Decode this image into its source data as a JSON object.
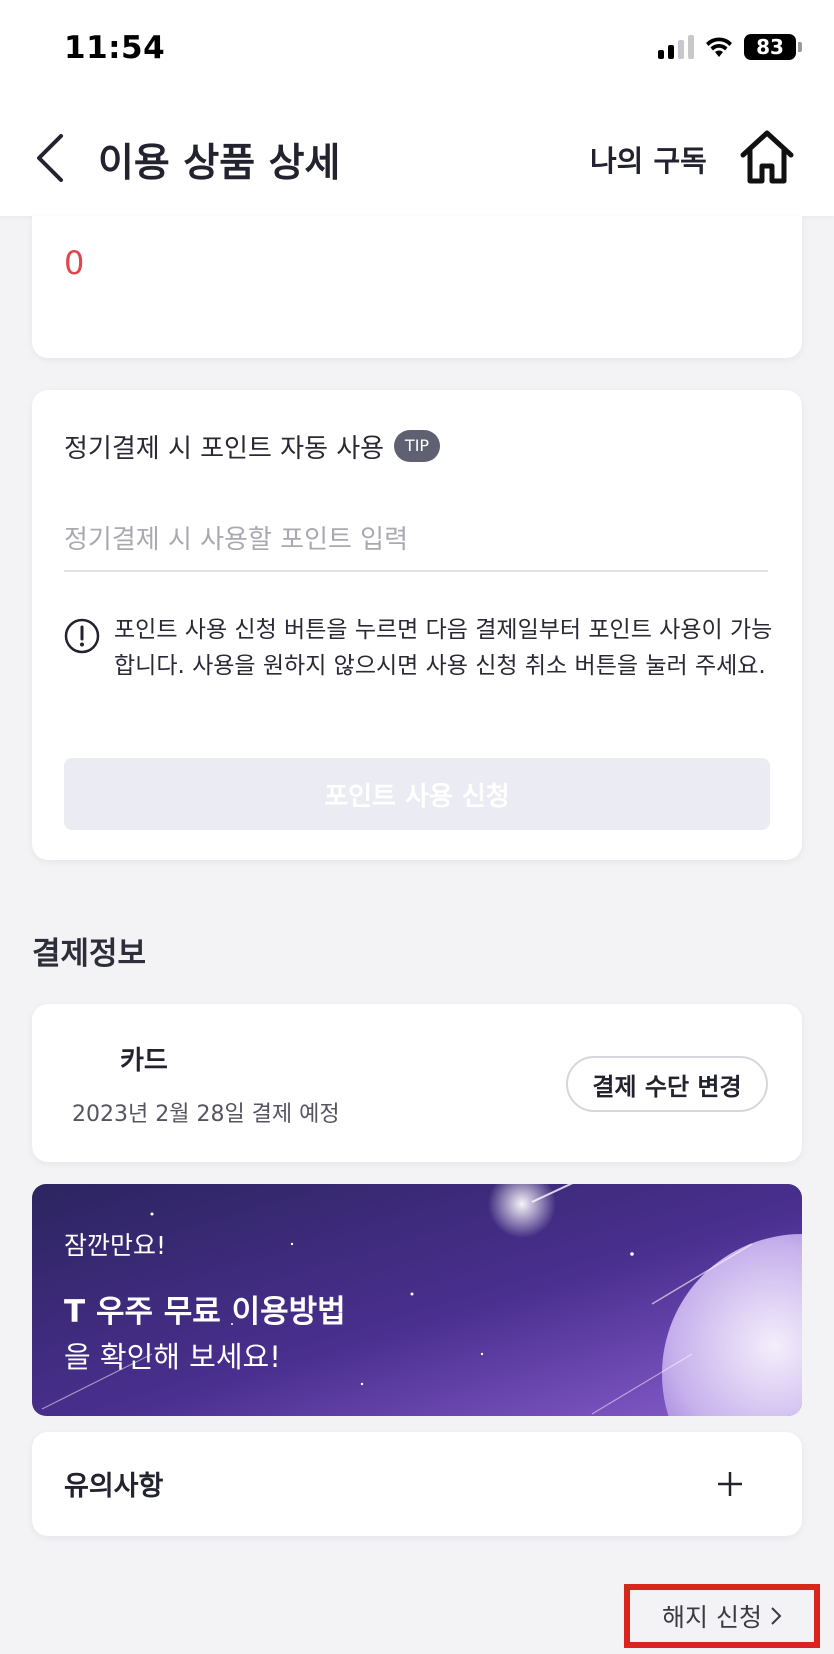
{
  "status_bar": {
    "time": "11:54",
    "battery": "83"
  },
  "header": {
    "title": "이용 상품 상세",
    "my_subscription": "나의 구독"
  },
  "point_card": {
    "value": "0"
  },
  "auto_point": {
    "title": "정기결제 시 포인트 자동 사용",
    "tip_badge": "TIP",
    "input_placeholder": "정기결제 시 사용할 포인트 입력",
    "notice": "포인트 사용 신청 버튼을 누르면 다음 결제일부터 포인트 사용이 가능합니다. 사용을 원하지 않으시면 사용 신청 취소 버튼을 눌러 주세요.",
    "apply_button": "포인트 사용 신청"
  },
  "payment": {
    "section_title": "결제정보",
    "method": "카드",
    "next_date": "2023년 2월 28일 결제 예정",
    "change_button": "결제 수단 변경"
  },
  "banner": {
    "subtitle": "잠깐만요!",
    "title": "T 우주 무료 이용방법",
    "description": "을 확인해 보세요!"
  },
  "notes": {
    "title": "유의사항"
  },
  "cancel": {
    "label": "해지 신청",
    "highlight_color": "#d8261f"
  },
  "colors": {
    "point_value": "#e0474c",
    "tip_badge": "#5f6172",
    "disabled_button": "#ebebf3"
  },
  "icons": [
    "back-arrow-icon",
    "home-icon",
    "alert-circle-icon",
    "plus-icon",
    "chevron-right-icon"
  ]
}
